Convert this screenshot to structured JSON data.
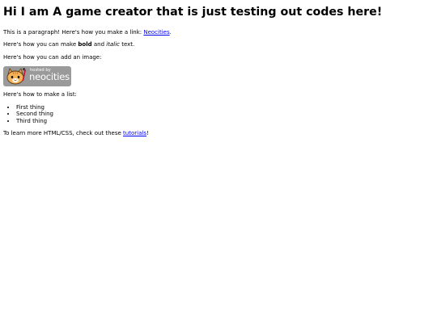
{
  "heading": "Hi I am A game creator that is just testing out codes here!",
  "paragraph1": {
    "text": "This is a paragraph! Here's how you make a link: ",
    "link_text": "Neocities",
    "suffix": "."
  },
  "paragraph2": {
    "prefix": "Here's how you can make ",
    "bold": "bold",
    "middle": " and ",
    "italic": "italic",
    "suffix": " text."
  },
  "paragraph3": "Here's how you can add an image:",
  "image_badge": {
    "small_text": "hosted by",
    "big_text": "neocities",
    "icon": "neocities-cat-icon"
  },
  "paragraph4": "Here's how to make a list:",
  "list_items": [
    "First thing",
    "Second thing",
    "Third thing"
  ],
  "paragraph5": {
    "prefix": "To learn more HTML/CSS, check out these ",
    "link_text": "tutorials",
    "suffix": "!"
  },
  "colors": {
    "link": "#0000ee",
    "badge_bg": "#9a9a9a",
    "text": "#000000"
  }
}
